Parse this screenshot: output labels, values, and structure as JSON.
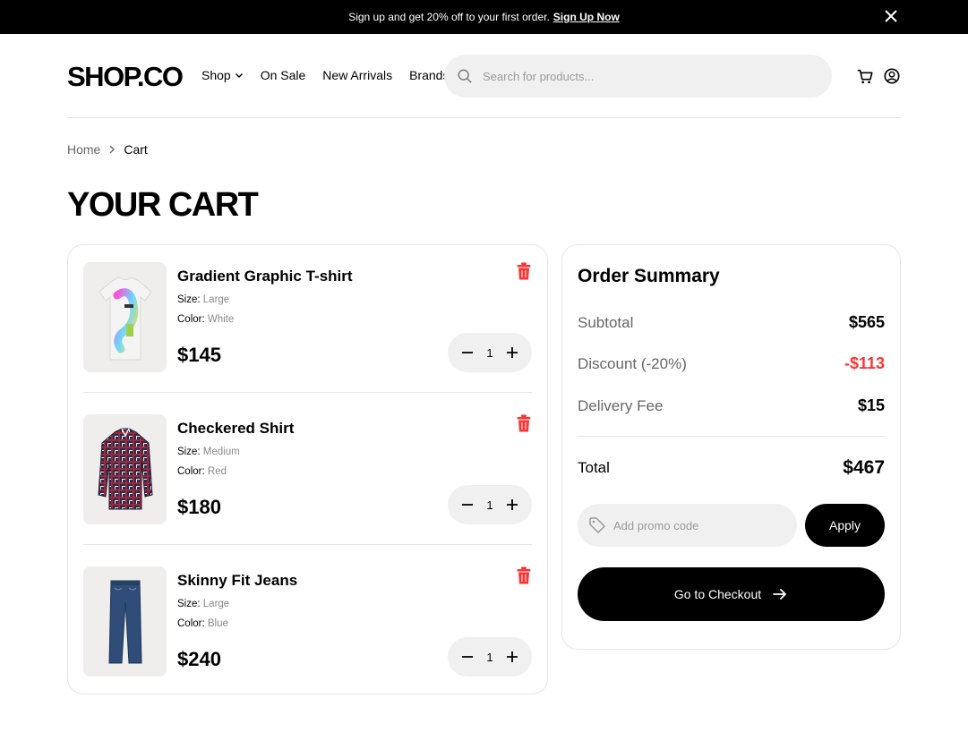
{
  "banner": {
    "text": "Sign up and get 20% off to your first order.",
    "link": "Sign Up Now",
    "close_icon": "close-icon"
  },
  "header": {
    "logo": "SHOP.CO",
    "nav": [
      {
        "label": "Shop",
        "icon": "chevron-down-icon"
      },
      {
        "label": "On Sale"
      },
      {
        "label": "New Arrivals"
      },
      {
        "label": "Brands"
      }
    ],
    "search_placeholder": "Search for products...",
    "icons": [
      "cart-icon",
      "user-icon"
    ]
  },
  "breadcrumb": {
    "home": "Home",
    "current": "Cart"
  },
  "page_title": "YOUR CART",
  "cart": {
    "items": [
      {
        "name": "Gradient Graphic T-shirt",
        "size_label": "Size:",
        "size": "Large",
        "color_label": "Color:",
        "color": "White",
        "price": "$145",
        "qty": "1"
      },
      {
        "name": "Checkered Shirt",
        "size_label": "Size:",
        "size": "Medium",
        "color_label": "Color:",
        "color": "Red",
        "price": "$180",
        "qty": "1"
      },
      {
        "name": "Skinny Fit Jeans",
        "size_label": "Size:",
        "size": "Large",
        "color_label": "Color:",
        "color": "Blue",
        "price": "$240",
        "qty": "1"
      }
    ]
  },
  "summary": {
    "title": "Order Summary",
    "subtotal_label": "Subtotal",
    "subtotal": "$565",
    "discount_label": "Discount (-20%)",
    "discount": "-$113",
    "delivery_label": "Delivery Fee",
    "delivery": "$15",
    "total_label": "Total",
    "total": "$467",
    "promo_placeholder": "Add promo code",
    "apply": "Apply",
    "checkout": "Go to Checkout"
  },
  "colors": {
    "accent": "#000000",
    "danger": "#ff3333",
    "muted_bg": "#f0f0f0"
  }
}
